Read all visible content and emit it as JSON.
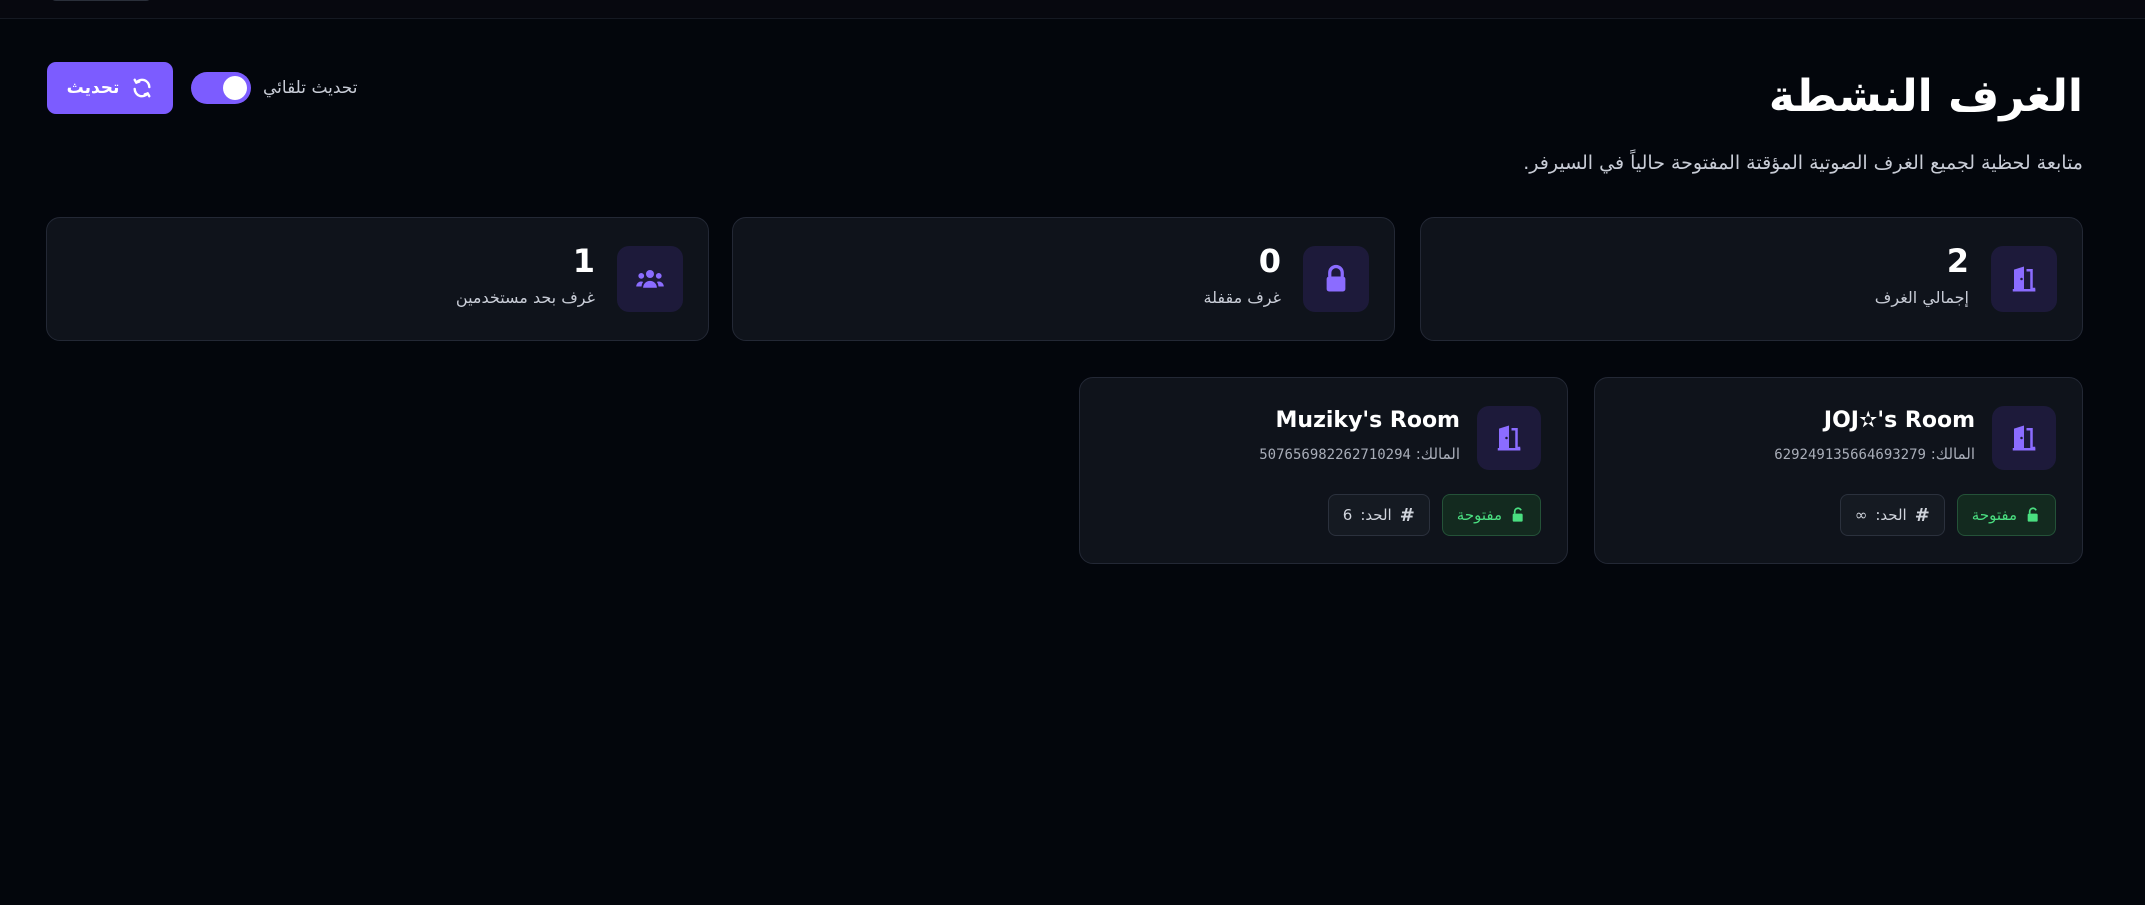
{
  "header": {
    "title": "الغرف النشطة",
    "subtitle": "متابعة لحظية لجميع الغرف الصوتية المؤقتة المفتوحة حالياً في السيرفر.",
    "auto_refresh_label": "تحديث تلقائي",
    "auto_refresh_on": true,
    "refresh_button_label": "تحديث"
  },
  "stats": [
    {
      "value": "2",
      "label": "إجمالي الغرف",
      "icon": "door-open-icon"
    },
    {
      "value": "0",
      "label": "غرف مقفلة",
      "icon": "lock-icon"
    },
    {
      "value": "1",
      "label": "غرف بحد مستخدمين",
      "icon": "users-icon"
    }
  ],
  "rooms": [
    {
      "name": "JOJ✫'s Room",
      "owner_label": "المالك:",
      "owner_id": "629249135664693279",
      "status": "مفتوحة",
      "limit_label": "الحد:",
      "limit_value": "∞",
      "icon": "door-open-icon"
    },
    {
      "name": "Muziky's Room",
      "owner_label": "المالك:",
      "owner_id": "507656982262710294",
      "status": "مفتوحة",
      "limit_label": "الحد:",
      "limit_value": "6",
      "icon": "door-open-icon"
    }
  ],
  "colors": {
    "accent": "#7c5cff",
    "open_status": "#4ade80",
    "background": "#03060c",
    "card": "#0f131b"
  }
}
